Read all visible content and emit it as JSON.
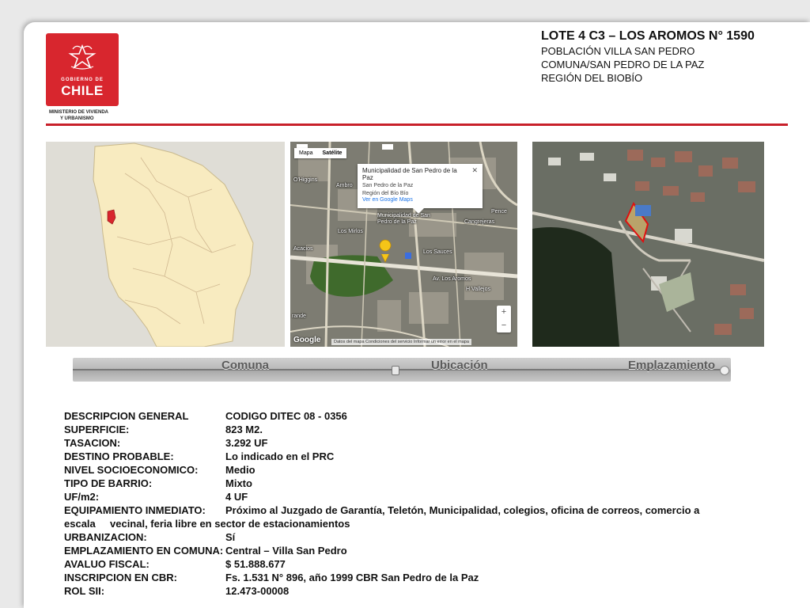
{
  "logo": {
    "gobierno": "GOBIERNO DE",
    "chile": "CHILE",
    "ministry_line1": "MINISTERIO DE VIVIENDA",
    "ministry_line2": "Y URBANISMO",
    "brand_color": "#d8262e"
  },
  "header": {
    "title": "LOTE 4 C3 – LOS AROMOS N° 1590",
    "line1": "POBLACIÓN  VILLA SAN PEDRO",
    "line2": "COMUNA/SAN PEDRO DE LA PAZ",
    "line3": "REGIÓN DEL BIOBÍO"
  },
  "map": {
    "tab_map": "Mapa",
    "tab_satellite": "Satélite",
    "info_name": "Municipalidad de San Pedro de la Paz",
    "info_city": "San Pedro de la Paz",
    "info_region": "Región del Bío Bío",
    "info_link": "Ver en Google Maps",
    "close": "✕",
    "streets": {
      "ohiggins": "O'Higgins",
      "ambrosio": "Ambro",
      "municipalidad": "Municipalidad de San Pedro de la Paz",
      "los_mirlos": "Los Mirlos",
      "acacios": "Acacios",
      "los_sauces": "Los Sauces",
      "av_aromos": "Av. Los Aromos",
      "cangrejeras": "Cangrejeras",
      "pence": "Pence",
      "vallejos": "H Vallejos",
      "grande": "rande"
    },
    "route_100": "100",
    "route_160": "160",
    "zoom_in": "+",
    "zoom_out": "−",
    "google": "Google",
    "attribution": "Datos del mapa   Condiciones del servicio   Informar un error en el mapa"
  },
  "slider": {
    "label_comuna": "Comuna",
    "label_ubicacion": "Ubicación",
    "label_emplazamiento": "Emplazamiento"
  },
  "details": [
    {
      "label": "DESCRIPCION GENERAL",
      "value": "CODIGO DITEC 08 - 0356"
    },
    {
      "label": "SUPERFICIE:",
      "value": "823 M2."
    },
    {
      "label": "TASACION:",
      "value": "3.292 UF"
    },
    {
      "label": "DESTINO PROBABLE:",
      "value": "Lo indicado en el PRC"
    },
    {
      "label": "NIVEL SOCIOECONOMICO:",
      "value": "Medio"
    },
    {
      "label": "TIPO DE BARRIO:",
      "value": "Mixto"
    },
    {
      "label": "UF/m2:",
      "value": "4 UF"
    },
    {
      "label": "EQUIPAMIENTO INMEDIATO:",
      "value": "Próximo al Juzgado de Garantía, Teletón, Municipalidad, colegios, oficina de correos, comercio a"
    },
    {
      "label": "escala",
      "value": "vecinal, feria libre en sector de estacionamientos"
    },
    {
      "label": "URBANIZACION:",
      "value": "Sí"
    },
    {
      "label": "EMPLAZAMIENTO EN COMUNA:",
      "value": "Central – Villa San Pedro"
    },
    {
      "label": "AVALUO FISCAL:",
      "value": "$ 51.888.677"
    },
    {
      "label": "INSCRIPCION EN CBR:",
      "value": "Fs. 1.531 N° 896, año 1999 CBR San Pedro de la Paz"
    },
    {
      "label": "ROL SII:",
      "value": "12.473-00008"
    }
  ]
}
